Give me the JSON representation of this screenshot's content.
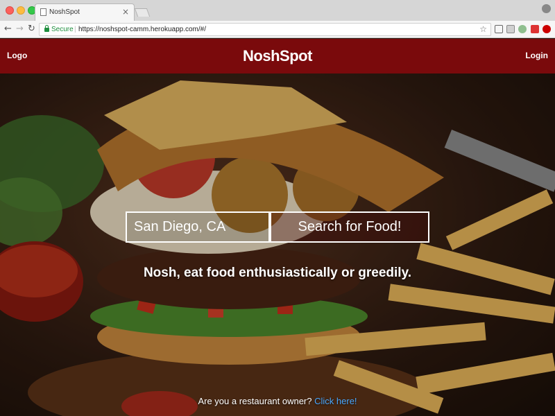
{
  "browser": {
    "tab_title": "NoshSpot",
    "tab_close": "×",
    "secure_label": "Secure",
    "url": "https://noshspot-camm.herokuapp.com/#/",
    "back_glyph": "←",
    "forward_glyph": "→",
    "reload_glyph": "C",
    "star_glyph": "☆"
  },
  "header": {
    "logo_label": "Logo",
    "brand": "NoshSpot",
    "login_label": "Login",
    "background_color": "#7a0a0c"
  },
  "search": {
    "location_value": "San Diego, CA",
    "button_label": "Search for Food!"
  },
  "hero": {
    "tagline": "Nosh, eat food enthusiastically or greedily."
  },
  "footer": {
    "owner_prompt": "Are you a restaurant owner?",
    "owner_link": "Click here!",
    "link_color": "#4aa8ff"
  },
  "icons": [
    "lock-icon",
    "star-icon",
    "cast-icon",
    "reload-icon",
    "back-icon",
    "forward-icon"
  ]
}
